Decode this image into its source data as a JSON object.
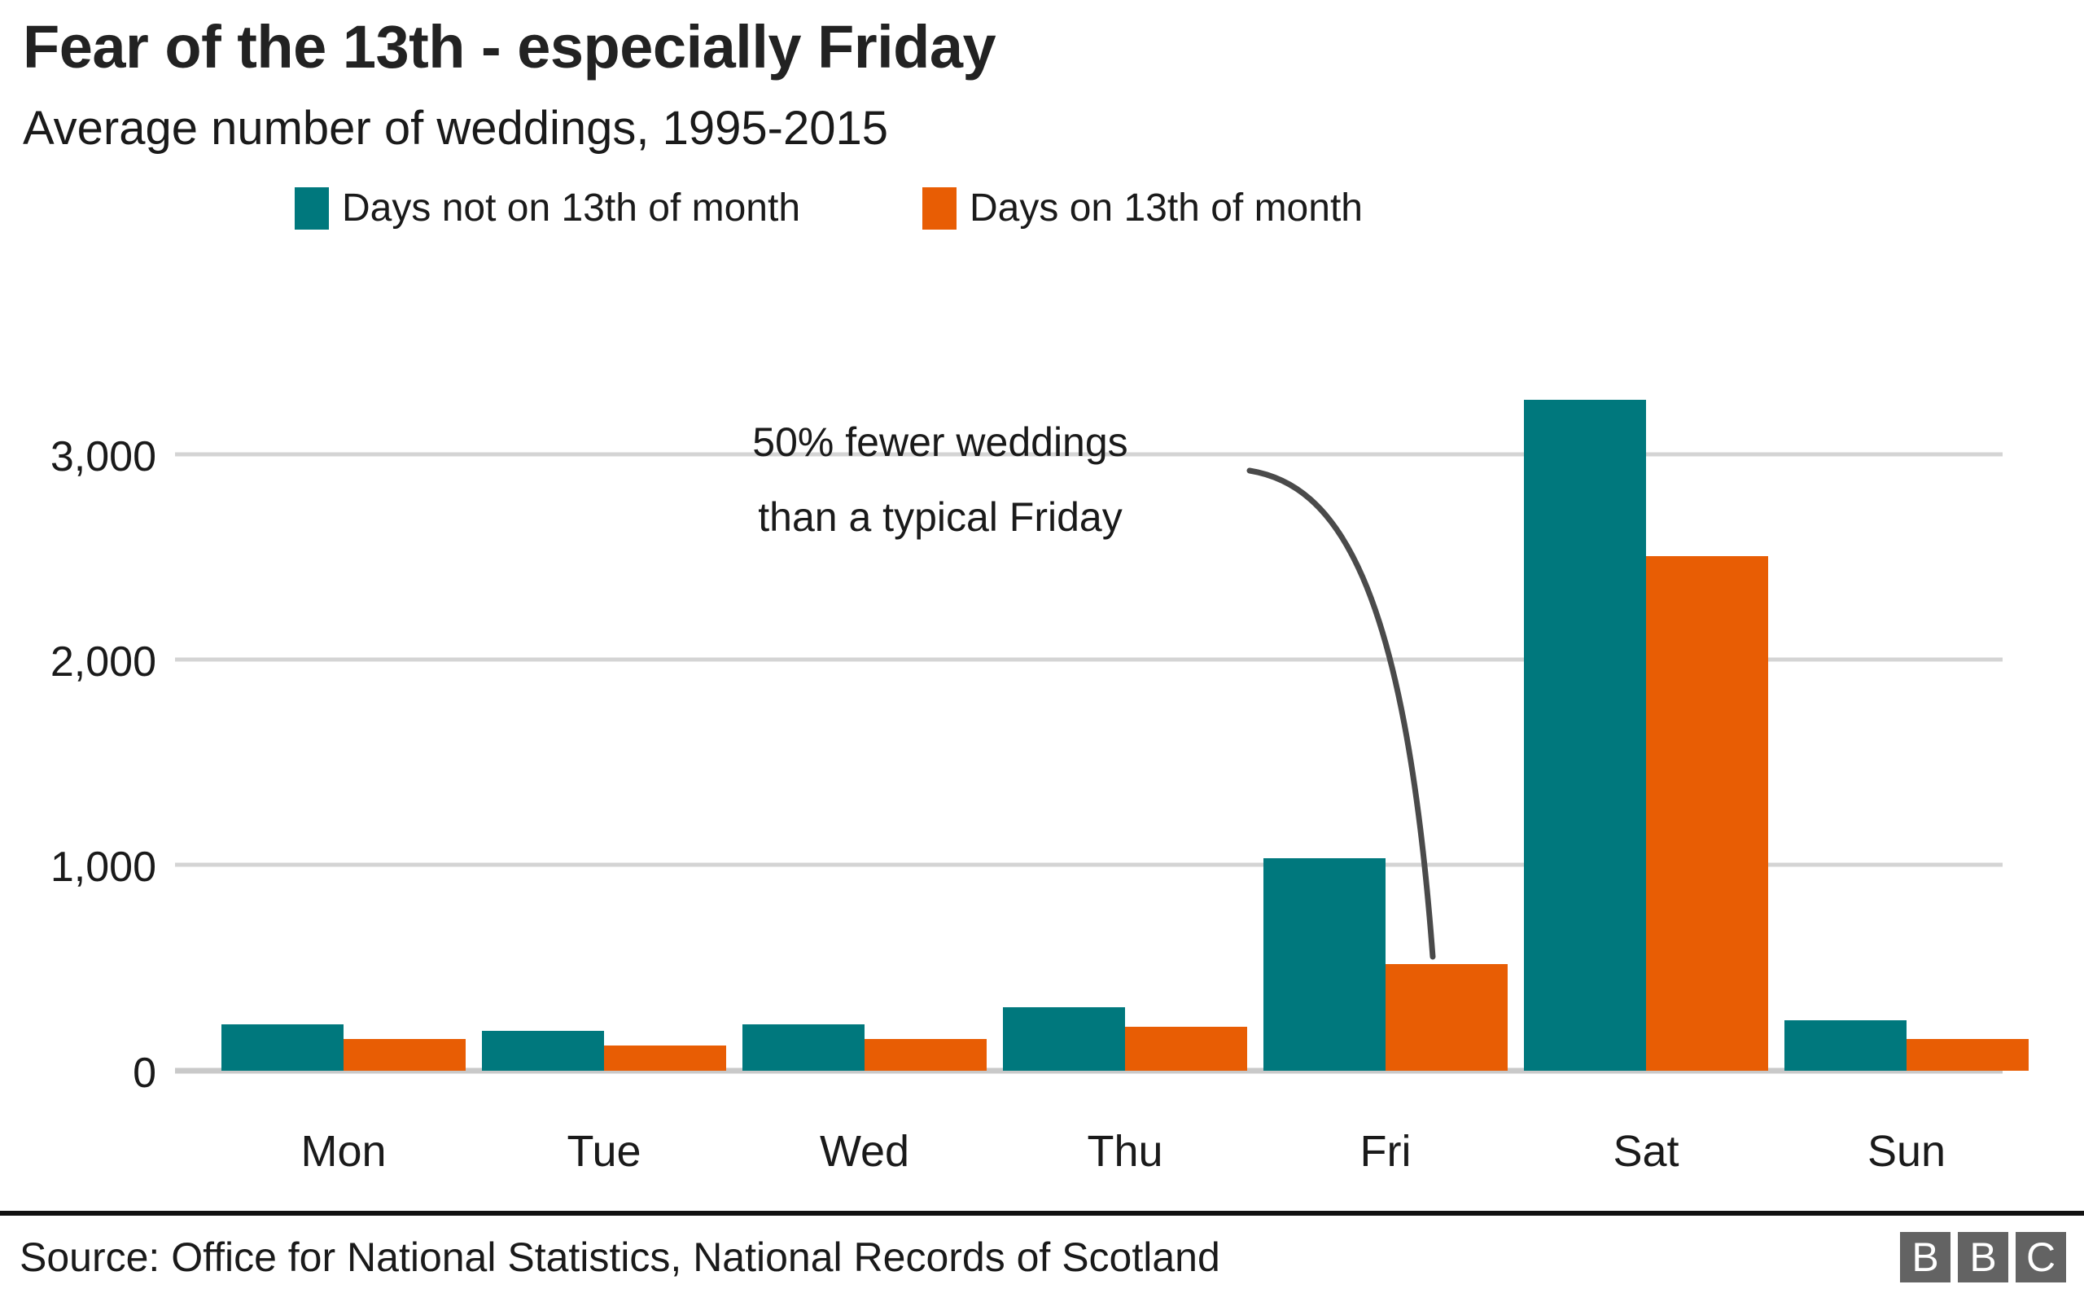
{
  "header": {
    "title": "Fear of the 13th - especially Friday",
    "subtitle": "Average number of weddings, 1995-2015"
  },
  "legend": {
    "position": "top",
    "items": [
      {
        "label": "Days not on 13th of month",
        "color": "#00787D",
        "icon": "legend-swatch-teal"
      },
      {
        "label": "Days on 13th of month",
        "color": "#E85D04",
        "icon": "legend-swatch-orange"
      }
    ]
  },
  "annotation": {
    "line1": "50% fewer weddings",
    "line2": "than a typical Friday"
  },
  "axis": {
    "y_ticks": [
      "0",
      "1,000",
      "2,000",
      "3,000"
    ],
    "x_ticks": [
      "Mon",
      "Tue",
      "Wed",
      "Thu",
      "Fri",
      "Sat",
      "Sun"
    ]
  },
  "footer": {
    "source": "Source: Office for National Statistics, National Records of Scotland",
    "logo": [
      "B",
      "B",
      "C"
    ]
  },
  "colors": {
    "teal": "#00787D",
    "orange": "#E85D04",
    "grid": "#d4d4d4",
    "text": "#1a1a1a",
    "logo_box": "#636363"
  },
  "chart_data": {
    "type": "bar",
    "title": "Fear of the 13th - especially Friday",
    "subtitle": "Average number of weddings, 1995-2015",
    "xlabel": "",
    "ylabel": "",
    "ylim": [
      0,
      3400
    ],
    "yticks": [
      0,
      1000,
      2000,
      3000
    ],
    "grid": true,
    "legend_position": "top",
    "categories": [
      "Mon",
      "Tue",
      "Wed",
      "Thu",
      "Fri",
      "Sat",
      "Sun"
    ],
    "series": [
      {
        "name": "Days not on 13th of month",
        "color": "#00787D",
        "values": [
          226,
          195,
          226,
          310,
          1035,
          3270,
          246
        ]
      },
      {
        "name": "Days on 13th of month",
        "color": "#E85D04",
        "values": [
          155,
          123,
          155,
          214,
          520,
          2508,
          155
        ]
      }
    ],
    "annotations": [
      {
        "text": "50% fewer weddings than a typical Friday",
        "target_category": "Fri",
        "target_series": "Days on 13th of month"
      }
    ]
  }
}
